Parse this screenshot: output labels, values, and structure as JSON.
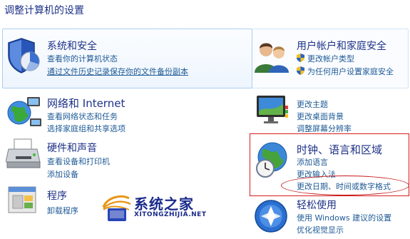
{
  "page_title": "调整计算机的设置",
  "categories": {
    "system": {
      "title": "系统和安全",
      "links": [
        "查看你的计算机状态",
        "通过文件历史记录保存你的文件备份副本"
      ]
    },
    "network": {
      "title": "网络和 Internet",
      "links": [
        "查看网络状态和任务",
        "选择家庭组和共享选项"
      ]
    },
    "hardware": {
      "title": "硬件和声音",
      "links": [
        "查看设备和打印机",
        "添加设备"
      ]
    },
    "programs": {
      "title": "程序",
      "links": [
        "卸载程序"
      ]
    },
    "users": {
      "title": "用户帐户和家庭安全",
      "links": [
        "更改帐户类型",
        "为任何用户设置家庭安全"
      ]
    },
    "appearance": {
      "links": [
        "更改主题",
        "更改桌面背景",
        "调整屏幕分辨率"
      ]
    },
    "clock": {
      "title": "时钟、语言和区域",
      "links": [
        "添加语言",
        "更改输入法",
        "更改日期、时间或数字格式"
      ]
    },
    "ease": {
      "title": "轻松使用",
      "links": [
        "使用 Windows 建议的设置",
        "优化视觉显示"
      ]
    }
  },
  "watermark": {
    "text": "系统之家",
    "url": "XITONGZHIJIA.NET"
  },
  "colors": {
    "title": "#1e3287",
    "link": "#1e5a96",
    "highlight": "#d81c1c"
  }
}
